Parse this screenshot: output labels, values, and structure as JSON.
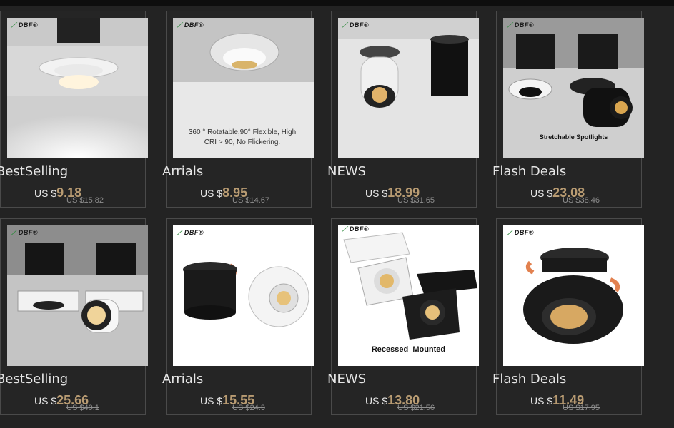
{
  "brand_logo": "DBF",
  "cards": [
    {
      "category": "BestSelling",
      "currency": "US $",
      "price": "9.18",
      "old_price": "US $15.82",
      "image_caption": ""
    },
    {
      "category": "Arrials",
      "currency": "US $",
      "price": "8.95",
      "old_price": "US $14.67",
      "image_caption": "360 ° Rotatable,90° Flexible, High CRI > 90, No Flickering."
    },
    {
      "category": "NEWS",
      "currency": "US $",
      "price": "18.99",
      "old_price": "US $31.65",
      "image_caption": ""
    },
    {
      "category": "Flash Deals",
      "currency": "US $",
      "price": "23.08",
      "old_price": "US $38.46",
      "image_caption": "Stretchable Spotlights"
    },
    {
      "category": "BestSelling",
      "currency": "US $",
      "price": "25.66",
      "old_price": "US $40.1",
      "image_caption": ""
    },
    {
      "category": "Arrials",
      "currency": "US $",
      "price": "15.55",
      "old_price": "US $24.3",
      "image_caption": ""
    },
    {
      "category": "NEWS",
      "currency": "US $",
      "price": "13.80",
      "old_price": "US $21.56",
      "image_caption": "Recessed  Mounted"
    },
    {
      "category": "Flash Deals",
      "currency": "US $",
      "price": "11.49",
      "old_price": "US $17.95",
      "image_caption": ""
    }
  ],
  "colors": {
    "background": "#232323",
    "price_accent": "#b89b72",
    "card_border": "#4a4a4a"
  }
}
